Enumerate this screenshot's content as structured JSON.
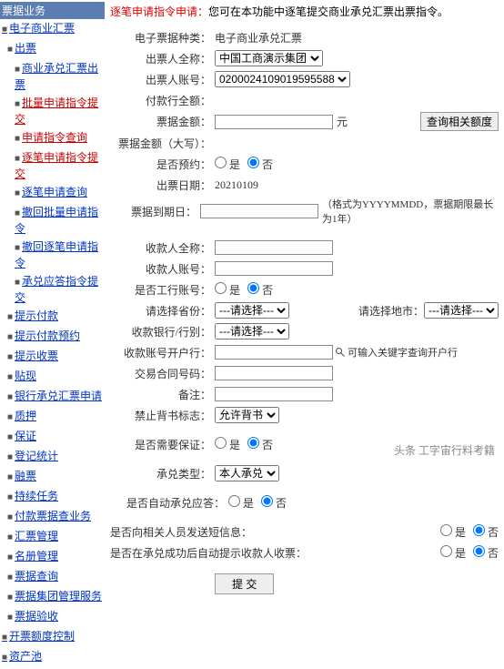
{
  "header": {
    "title_1": "逐笔申请指令申请：",
    "title_2": "您可在本功能中逐笔提交商业承兑汇票出票指令。"
  },
  "nav": {
    "top": "票据业务",
    "items": [
      {
        "label": "电子商业汇票",
        "cls": "lvl1"
      },
      {
        "label": "出票",
        "cls": "lvl2"
      },
      {
        "label": "商业承兑汇票出票",
        "cls": "lvl3"
      },
      {
        "label": "批量申请指令提交",
        "cls": "lvl3 red"
      },
      {
        "label": "申请指令查询",
        "cls": "lvl3 red"
      },
      {
        "label": "逐笔申请指令提交",
        "cls": "lvl3 red"
      },
      {
        "label": "逐笔申请查询",
        "cls": "lvl3"
      },
      {
        "label": "撤回批量申请指令",
        "cls": "lvl3"
      },
      {
        "label": "撤回逐笔申请指令",
        "cls": "lvl3"
      },
      {
        "label": "承兑应答指令提交",
        "cls": "lvl3"
      },
      {
        "label": "提示付款",
        "cls": "lvl2"
      },
      {
        "label": "提示付款预约",
        "cls": "lvl2"
      },
      {
        "label": "提示收票",
        "cls": "lvl2"
      },
      {
        "label": "贴现",
        "cls": "lvl2"
      },
      {
        "label": "银行承兑汇票申请",
        "cls": "lvl2"
      },
      {
        "label": "质押",
        "cls": "lvl2"
      },
      {
        "label": "保证",
        "cls": "lvl2"
      },
      {
        "label": "登记统计",
        "cls": "lvl2"
      },
      {
        "label": "融票",
        "cls": "lvl2"
      },
      {
        "label": "持续任务",
        "cls": "lvl2"
      },
      {
        "label": "付款票据查业务",
        "cls": "lvl2"
      },
      {
        "label": "汇票管理",
        "cls": "lvl2"
      },
      {
        "label": "名册管理",
        "cls": "lvl2"
      },
      {
        "label": "票据查询",
        "cls": "lvl2"
      },
      {
        "label": "票据集团管理服务",
        "cls": "lvl2"
      },
      {
        "label": "票据验收",
        "cls": "lvl2"
      },
      {
        "label": "开票额度控制",
        "cls": "lvl1"
      },
      {
        "label": "资产池",
        "cls": "lvl1"
      }
    ]
  },
  "form": {
    "f1_lbl": "电子票据种类：",
    "f1_val": "电子商业承兑汇票",
    "f2_lbl": "出票人全称：",
    "f2_val": "中国工商演示集团",
    "f3_lbl": "出票人账号：",
    "f3_val": "0200024109019595588",
    "f4_lbl": "付款行全额：",
    "f5_lbl": "票据金额：",
    "f5_unit": "元",
    "f5_btn": "查询相关额度",
    "f6_lbl": "票据金额（大写）：",
    "f7_lbl": "是否预约：",
    "f7a": "是",
    "f7b": "否",
    "f8_lbl": "出票日期：",
    "f8_val": "20210109",
    "f9_lbl": "票据到期日：",
    "f9_hint": "（格式为YYYYMMDD，票据期限最长为1年）",
    "f10_lbl": "收款人全称：",
    "f11_lbl": "收款人账号：",
    "f12_lbl": "是否工行账号：",
    "f12a": "是",
    "f12b": "否",
    "f13_lbl": "请选择省份：",
    "f13_val": "---请选择---",
    "f13_rlbl": "请选择地市：",
    "f13_rval": "---请选择---",
    "f14_lbl": "收款银行/行别：",
    "f14_val": "---请选择---",
    "f15_lbl": "收款账号开户行：",
    "f15_icon_title": "search",
    "f15_hint": "可输入关键字查询开户行",
    "f16_lbl": "交易合同号码：",
    "f17_lbl": "备注：",
    "f18_lbl": "禁止背书标志：",
    "f18_val": "允许背书",
    "f19_lbl": "是否需要保证：",
    "f19a": "是",
    "f19b": "否",
    "f20_lbl": "承兑类型：",
    "f20_val": "本人承兑",
    "f21_lbl": "是否自动承兑应答：",
    "f21a": "是",
    "f21b": "否",
    "f22_lbl": "是否向相关人员发送短信息：",
    "f22a": "是",
    "f22b": "否",
    "f23_lbl": "是否在承兑成功后自动提示收款人收票：",
    "f23a": "是",
    "f23b": "否",
    "submit": "提 交"
  },
  "placeholder_empty": "",
  "watermark": "头条 工字宙行料考籍"
}
